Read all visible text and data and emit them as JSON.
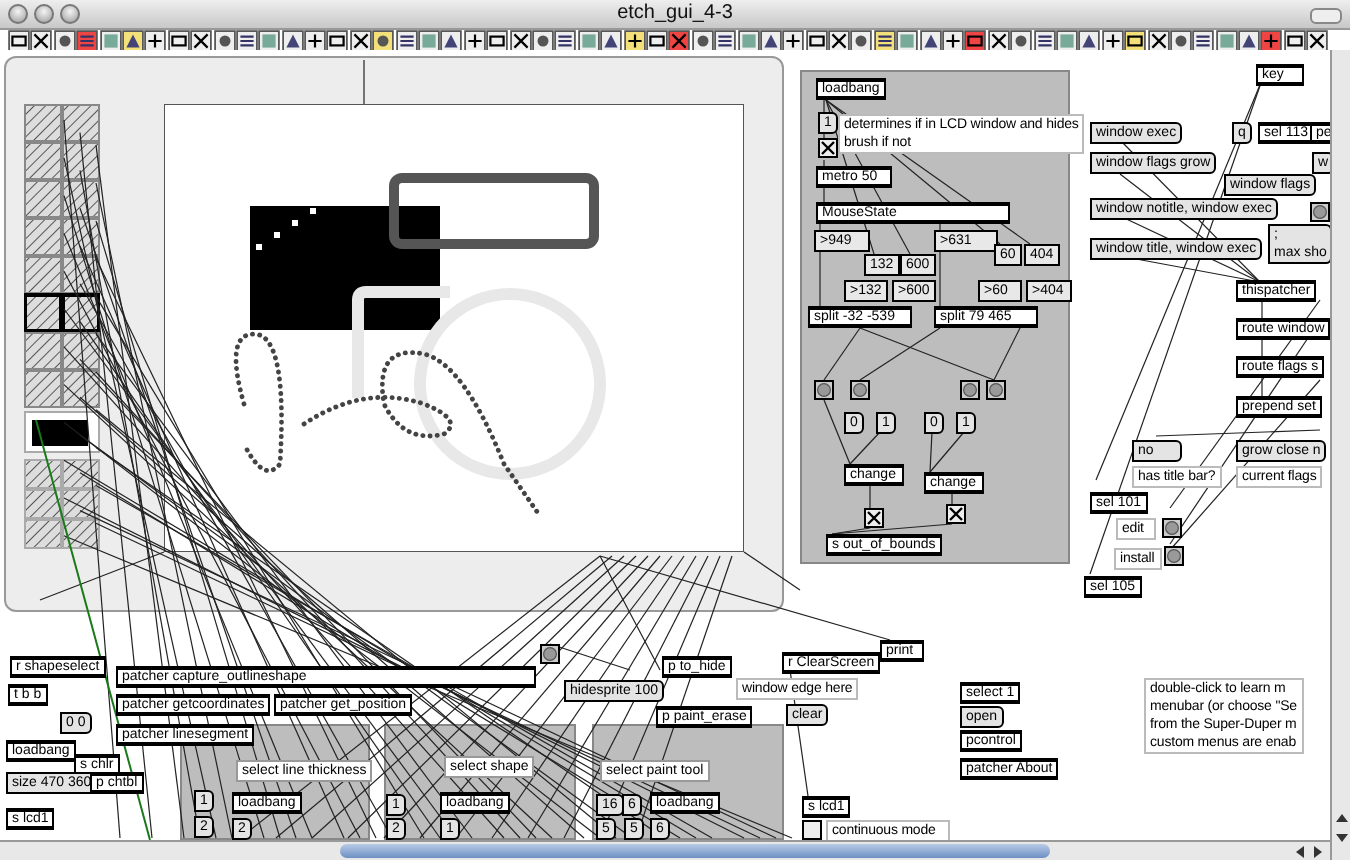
{
  "window": {
    "title": "etch_gui_4-3"
  },
  "subpanels": [
    {
      "label": "select line thickness"
    },
    {
      "label": "select shape"
    },
    {
      "label": "select paint tool"
    }
  ],
  "objects": [
    {
      "kind": "object",
      "text": "loadbang"
    },
    {
      "kind": "message",
      "text": "1"
    },
    {
      "kind": "comment",
      "text": "determines if in LCD window and hides\nbrush if not"
    },
    {
      "kind": "toggle",
      "checked": true
    },
    {
      "kind": "object",
      "text": "metro 50"
    },
    {
      "kind": "object",
      "text": "MouseState"
    },
    {
      "kind": "number",
      "text": ">949"
    },
    {
      "kind": "number",
      "text": "132"
    },
    {
      "kind": "number",
      "text": "600"
    },
    {
      "kind": "number",
      "text": ">132"
    },
    {
      "kind": "number",
      "text": ">600"
    },
    {
      "kind": "object",
      "text": "split -32 -539"
    },
    {
      "kind": "number",
      "text": ">631"
    },
    {
      "kind": "number",
      "text": "60"
    },
    {
      "kind": "number",
      "text": "404"
    },
    {
      "kind": "number",
      "text": ">60"
    },
    {
      "kind": "number",
      "text": ">404"
    },
    {
      "kind": "object",
      "text": "split 79 465"
    },
    {
      "kind": "bang"
    },
    {
      "kind": "bang"
    },
    {
      "kind": "bang"
    },
    {
      "kind": "bang"
    },
    {
      "kind": "message",
      "text": "0"
    },
    {
      "kind": "message",
      "text": "1"
    },
    {
      "kind": "message",
      "text": "0"
    },
    {
      "kind": "message",
      "text": "1"
    },
    {
      "kind": "object",
      "text": "change"
    },
    {
      "kind": "object",
      "text": "change"
    },
    {
      "kind": "toggle",
      "checked": true
    },
    {
      "kind": "toggle",
      "checked": true
    },
    {
      "kind": "object",
      "text": "s out_of_bounds"
    },
    {
      "kind": "object",
      "text": "key"
    },
    {
      "kind": "message",
      "text": "window exec"
    },
    {
      "kind": "message",
      "text": "q"
    },
    {
      "kind": "object",
      "text": "sel 113"
    },
    {
      "kind": "object",
      "text": "pe"
    },
    {
      "kind": "message",
      "text": "w"
    },
    {
      "kind": "message",
      "text": "window flags grow"
    },
    {
      "kind": "message",
      "text": "window flags"
    },
    {
      "kind": "bang"
    },
    {
      "kind": "message",
      "text": "window notitle, window exec"
    },
    {
      "kind": "message",
      "text": "window title, window exec"
    },
    {
      "kind": "message",
      "text": ";\nmax sho"
    },
    {
      "kind": "object",
      "text": "thispatcher"
    },
    {
      "kind": "object",
      "text": "route window"
    },
    {
      "kind": "object",
      "text": "route flags s"
    },
    {
      "kind": "object",
      "text": "prepend set"
    },
    {
      "kind": "message",
      "text": "no"
    },
    {
      "kind": "comment",
      "text": "has title bar?"
    },
    {
      "kind": "message",
      "text": "grow close n"
    },
    {
      "kind": "comment",
      "text": "current flags"
    },
    {
      "kind": "object",
      "text": "sel 101"
    },
    {
      "kind": "comment",
      "text": "edit"
    },
    {
      "kind": "bang"
    },
    {
      "kind": "comment",
      "text": "install"
    },
    {
      "kind": "bang"
    },
    {
      "kind": "object",
      "text": "sel 105"
    },
    {
      "kind": "object",
      "text": "r shapeselect"
    },
    {
      "kind": "object",
      "text": "patcher capture_outlineshape"
    },
    {
      "kind": "object",
      "text": "t b b"
    },
    {
      "kind": "object",
      "text": "patcher getcoordinates"
    },
    {
      "kind": "object",
      "text": "patcher get_position"
    },
    {
      "kind": "message",
      "text": "0 0"
    },
    {
      "kind": "object",
      "text": "patcher linesegment"
    },
    {
      "kind": "object",
      "text": "loadbang"
    },
    {
      "kind": "object",
      "text": "s chlr"
    },
    {
      "kind": "message",
      "text": "size 470 360"
    },
    {
      "kind": "object",
      "text": "p chtbl"
    },
    {
      "kind": "object",
      "text": "s lcd1"
    },
    {
      "kind": "bang"
    },
    {
      "kind": "object",
      "text": "p to_hide"
    },
    {
      "kind": "message",
      "text": "hidesprite 100"
    },
    {
      "kind": "comment",
      "text": "window edge here"
    },
    {
      "kind": "object",
      "text": "p paint_erase"
    },
    {
      "kind": "object",
      "text": "r ClearScreen"
    },
    {
      "kind": "object",
      "text": "print"
    },
    {
      "kind": "message",
      "text": "clear"
    },
    {
      "kind": "object",
      "text": "s lcd1"
    },
    {
      "kind": "toggle",
      "checked": false
    },
    {
      "kind": "comment",
      "text": "continuous mode"
    },
    {
      "kind": "object",
      "text": "select 1"
    },
    {
      "kind": "message",
      "text": "open"
    },
    {
      "kind": "object",
      "text": "pcontrol"
    },
    {
      "kind": "object",
      "text": "patcher About"
    },
    {
      "kind": "comment",
      "text": "double-click to learn m\nmenubar (or choose \"Se\nfrom the Super-Duper m\ncustom menus are enab"
    },
    {
      "kind": "message",
      "text": "1"
    },
    {
      "kind": "message",
      "text": "2"
    },
    {
      "kind": "object",
      "text": "loadbang"
    },
    {
      "kind": "message",
      "text": "2"
    },
    {
      "kind": "message",
      "text": "1"
    },
    {
      "kind": "message",
      "text": "2"
    },
    {
      "kind": "object",
      "text": "loadbang"
    },
    {
      "kind": "message",
      "text": "1"
    },
    {
      "kind": "message",
      "text": "16"
    },
    {
      "kind": "message",
      "text": "6"
    },
    {
      "kind": "object",
      "text": "loadbang"
    },
    {
      "kind": "message",
      "text": "5"
    },
    {
      "kind": "message",
      "text": "5"
    },
    {
      "kind": "message",
      "text": "6"
    }
  ]
}
